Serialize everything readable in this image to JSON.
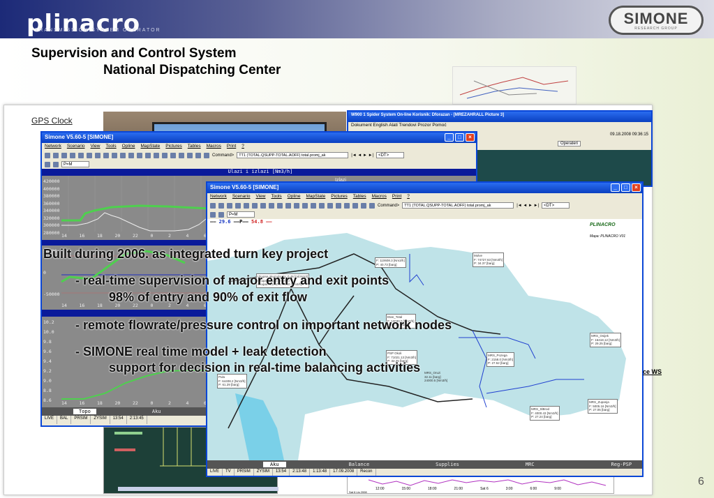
{
  "header": {
    "logo": "plinacro",
    "logo_tagline": "TRANSMISSION SYSTEM OPERATOR",
    "partner_logo": "SIMONE",
    "partner_tagline": "RESEARCH GROUP"
  },
  "slide": {
    "title_line1": "Supervision and Control System",
    "title_line2": "National Dispatching Center",
    "page_number": "6",
    "gps_label": "GPS Clock",
    "ws_link": "ce WS"
  },
  "bullets": {
    "intro": "Built during 2006. as integrated turn key project",
    "b1": "- real-time supervision of major entry and exit points",
    "b1_sub": "98% of entry and 90% of exit flow",
    "b2": "- remote flowrate/pressure control on important network nodes",
    "b3": "- SIMONE real time model + leak detection",
    "b3_sub": "support for decision in real-time balancing activities"
  },
  "w900": {
    "title": "W900 1 Spider System On-line Korisnik: Dforazan - [MREZAHRALL     Picture 3]",
    "menu": "Dokument English Alati Trendovi Prozor Pomoć",
    "datetime": "09.18.2008 09:36:15",
    "operator": "Operateri"
  },
  "window1": {
    "title": "Simone V5.60-5 [SIMONE]",
    "menu": [
      "Network",
      "Scenario",
      "View",
      "Tools",
      "Opline",
      "MapState",
      "Pictures",
      "Tables",
      "Macros",
      "Print",
      "?"
    ],
    "command_label": "Command>",
    "command_value": "TT1 (TOTAL.QSUPP-TOTAL.AOFF) total.promj_ak",
    "dt_select": "<DT>",
    "mode_select": "P=M",
    "chart_title": "Ulazi i izlazi [Nm3/h]",
    "legend": "Izlazi",
    "chart1_y": [
      "420000",
      "400000",
      "380000",
      "360000",
      "340000",
      "320000",
      "300000",
      "280000"
    ],
    "chart2_y": [
      "50000",
      "0",
      "-50000"
    ],
    "chart3_y": [
      "10.2",
      "10.0",
      "9.8",
      "9.6",
      "9.4",
      "9.2",
      "9.0",
      "8.8",
      "8.6"
    ],
    "x_ticks": [
      "14",
      "16",
      "18",
      "20",
      "22",
      "0",
      "2",
      "4",
      "6"
    ],
    "tabs": {
      "left": "Topo",
      "right": "Aku"
    },
    "status": [
      "LIVE",
      "BAL",
      "PRSIM",
      "ZYSIM",
      "13:54",
      "2:13:45"
    ]
  },
  "window2": {
    "title": "Simone V5.60-5 [SIMONE]",
    "menu": [
      "Network",
      "Scenario",
      "View",
      "Tools",
      "Opline",
      "MapState",
      "Pictures",
      "Tables",
      "Macros",
      "Print",
      "?"
    ],
    "command_label": "Command>",
    "command_value": "TT1 (TOTAL.QSUPP-TOTAL.AOFF) total.promj_ak",
    "dt_select": "<DT>",
    "mode_select": "P=M",
    "legend_left": "29.6",
    "legend_mid": "P",
    "legend_right": "54.8",
    "map_logo": "PLINACRO",
    "map_caption": "Mapa: PLINACRO V01",
    "labels": [
      "Ukupna akumulacija: 0.46 [mil.Nm3]\nUkupan ULAZ: 385640\nUkupan IZLAZ: 379860 [Nm3/h]",
      "Molve\nF: 74727.63 [Nm3/h]\nP: 34.37 [barg]",
      "F: 110608.3 [Nm3/h]\nP: 40.73 [barg]",
      "Etan_Total\nF: 12030.0 [Nm3/h]\nP: 32.69 [barg]",
      "PSP Okoli\nF: 71021.13 [Nm3/h]\nP: 32.25 [barg]",
      "MRS_Pozega\nF: 2158.0 [Nm3/h]\nP: 27.52 [barg]",
      "MRS_Osijek\nF: 16418.12 [Nm3/h]\nP: 29.25 [barg]",
      "MRS_Oruzi\n32.11 [barg]\n24000.5 [Nm3/h]",
      "Pula\nF: 64408.2 [Nm3/h]\nP: 61.29 [barg]",
      "MRS_SlBrod\nF: 4000.43 [Nm3/h]\nP: 27.24 [barg]",
      "MRS_Zupanja\nF: 5005.16 [Nm3/h]\nP: 27.05 [barg]"
    ],
    "tabs": [
      "Aku",
      "Balance",
      "Supplies",
      "MRC",
      "Reg-PSP"
    ],
    "status": [
      "LIVE",
      "TV",
      "PRSIM",
      "ZYSIM",
      "13:54",
      "2:13:48",
      "1:13:48",
      "17.09.2008",
      "Recon"
    ]
  },
  "bottom_chart": {
    "x_ticks": [
      "12:00",
      "15:00",
      "18:00",
      "21:00",
      "Sat 6",
      "3:00",
      "6:00",
      "9:00"
    ],
    "date": "Sat 6 Lis 2008"
  },
  "colors": {
    "xp_blue": "#0a46d6",
    "chart_bg": "#8a8a8a",
    "green_line": "#4ed04e"
  }
}
